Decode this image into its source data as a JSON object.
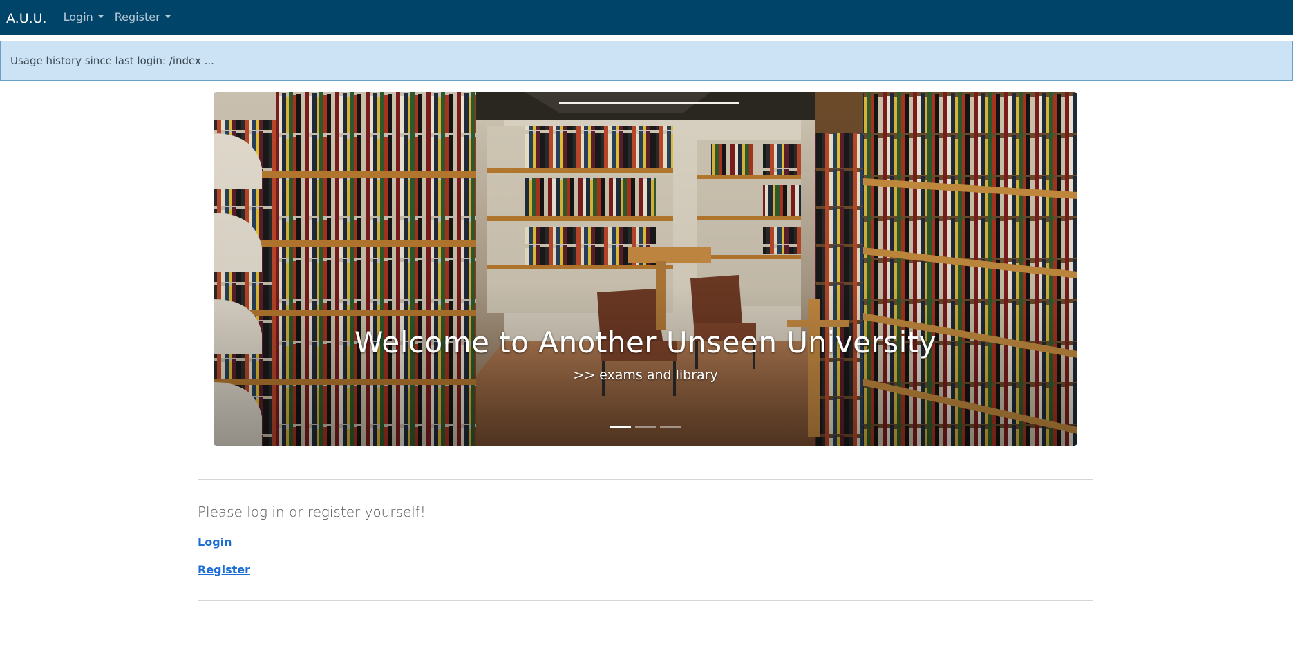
{
  "navbar": {
    "brand": "A.U.U.",
    "items": [
      {
        "label": "Login"
      },
      {
        "label": "Register"
      }
    ],
    "background": "#004569"
  },
  "alert": {
    "text": "Usage history since last login: /index ..."
  },
  "carousel": {
    "title": "Welcome to Another Unseen University",
    "subtitle": ">> exams and library",
    "slide_count": 3,
    "active_slide": 1
  },
  "main": {
    "prompt": "Please log in or register yourself!",
    "login_link": "Login",
    "register_link": "Register"
  }
}
